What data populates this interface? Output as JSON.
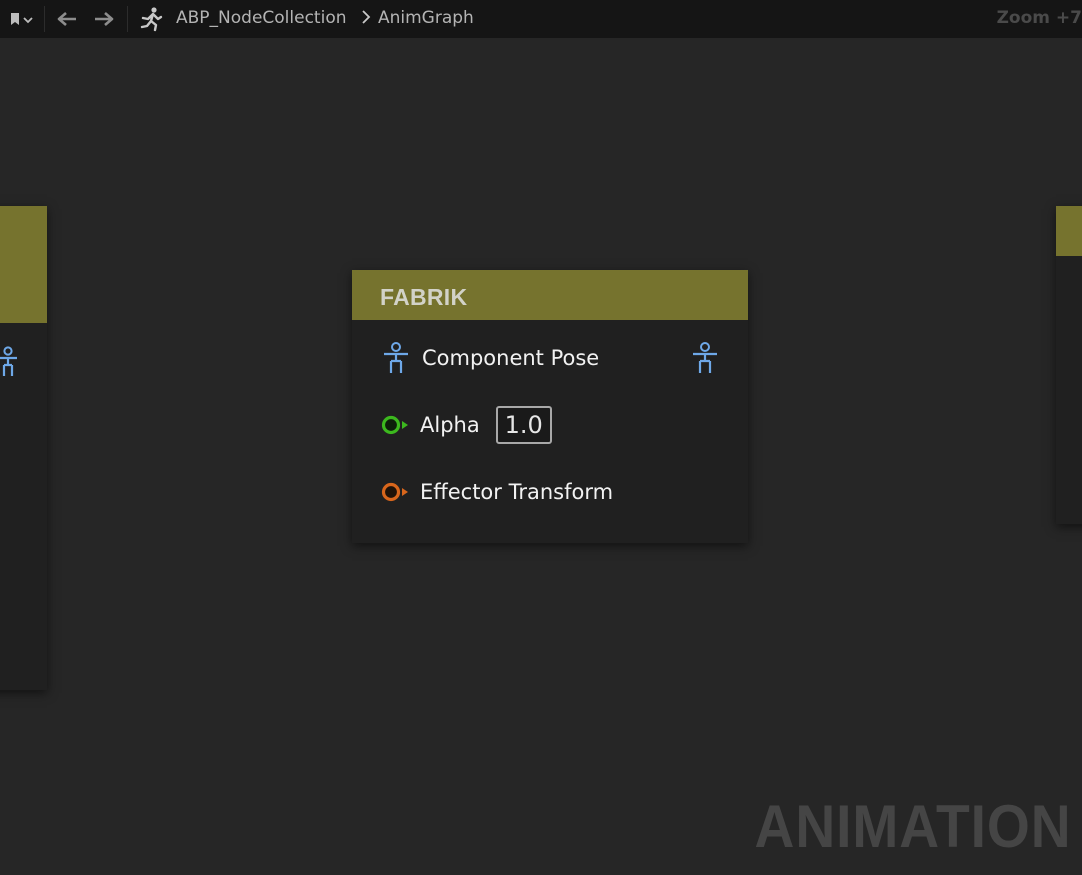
{
  "toolbar": {
    "bookmark_icon": "bookmark-icon",
    "back_icon": "arrow-left-icon",
    "forward_icon": "arrow-right-icon",
    "asset_icon": "running-man-icon",
    "breadcrumb": {
      "asset": "ABP_NodeCollection",
      "separator": ">",
      "graph": "AnimGraph"
    },
    "zoom_label": "Zoom +7"
  },
  "graph": {
    "node": {
      "title": "FABRIK",
      "header_color": "#76732e",
      "pins": [
        {
          "label": "Component Pose",
          "type": "pose",
          "color": "#6ea8e8"
        },
        {
          "label": "Alpha",
          "type": "float",
          "color": "#3cb81e",
          "value": "1.0"
        },
        {
          "label": "Effector Transform",
          "type": "transform",
          "color": "#d8661c"
        }
      ]
    },
    "watermark": "ANIMATION"
  }
}
